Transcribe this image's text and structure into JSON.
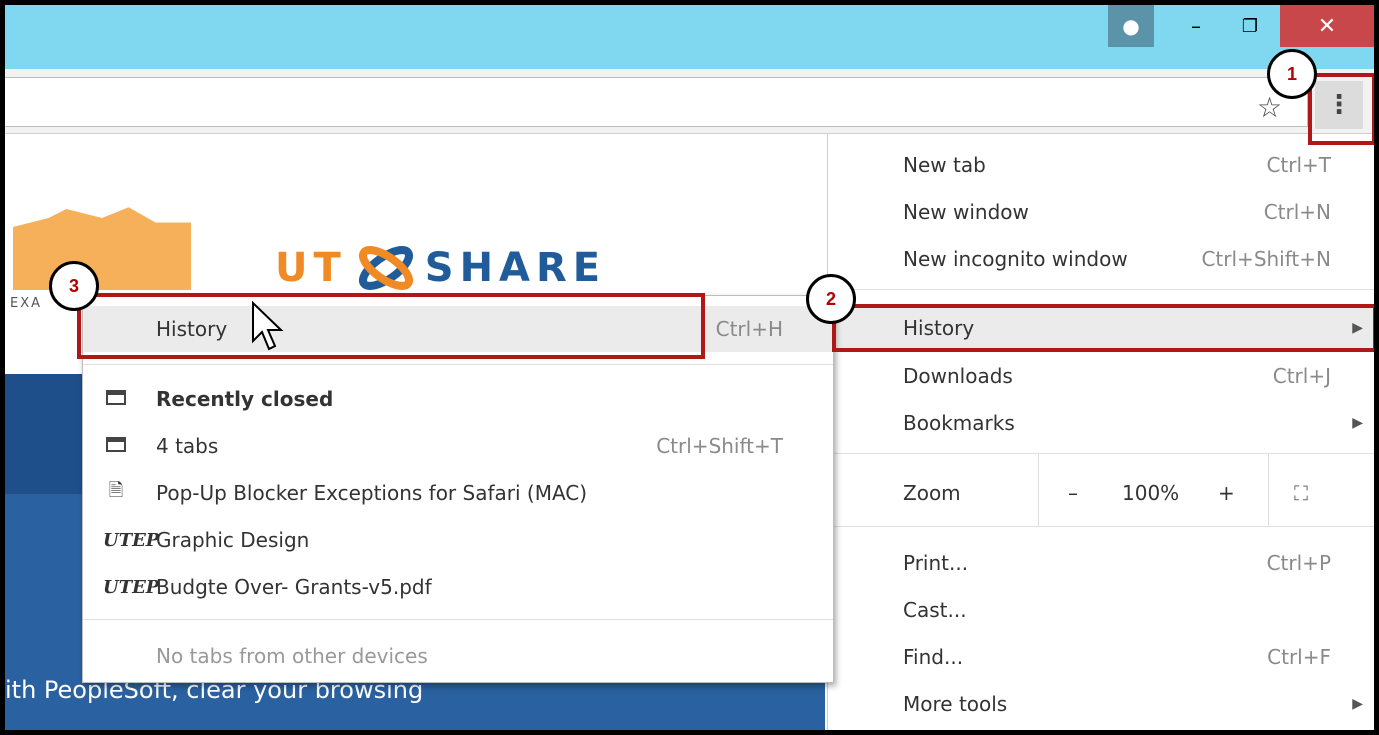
{
  "window": {
    "user_icon": "person-icon",
    "minimize": "–",
    "maximize": "❐",
    "close": "✕"
  },
  "toolbar": {
    "star_icon": "☆",
    "menu_icon": "⋮"
  },
  "page": {
    "logo_left": "UT",
    "logo_right": "SHARE",
    "exa": "EXA",
    "text": "ith PeopleSoft, clear your browsing"
  },
  "menu": {
    "items": [
      {
        "label": "New tab",
        "shortcut": "Ctrl+T"
      },
      {
        "label": "New window",
        "shortcut": "Ctrl+N"
      },
      {
        "label": "New incognito window",
        "shortcut": "Ctrl+Shift+N"
      },
      {
        "label": "History",
        "shortcut": ""
      },
      {
        "label": "Downloads",
        "shortcut": "Ctrl+J"
      },
      {
        "label": "Bookmarks",
        "shortcut": ""
      },
      {
        "label": "Zoom",
        "shortcut": ""
      },
      {
        "label": "Print...",
        "shortcut": "Ctrl+P"
      },
      {
        "label": "Cast...",
        "shortcut": ""
      },
      {
        "label": "Find...",
        "shortcut": "Ctrl+F"
      },
      {
        "label": "More tools",
        "shortcut": ""
      }
    ],
    "zoom": {
      "minus": "–",
      "value": "100%",
      "plus": "+",
      "fullscreen": "⛶"
    }
  },
  "history_submenu": {
    "history": {
      "label": "History",
      "shortcut": "Ctrl+H"
    },
    "recently_closed": "Recently closed",
    "items": [
      {
        "label": "4 tabs",
        "shortcut": "Ctrl+Shift+T",
        "icon": "tab-icon"
      },
      {
        "label": "Pop-Up Blocker Exceptions for Safari (MAC)",
        "shortcut": "",
        "icon": "page-icon"
      },
      {
        "label": "Graphic Design",
        "shortcut": "",
        "icon": "utep-icon"
      },
      {
        "label": "Budgte Over- Grants-v5.pdf",
        "shortcut": "",
        "icon": "utep-icon"
      }
    ],
    "no_tabs": "No tabs from other devices"
  },
  "callouts": {
    "one": "1",
    "two": "2",
    "three": "3"
  },
  "colors": {
    "titlebar": "#7fd8ef",
    "close": "#c8474b",
    "highlight_box": "#b01818"
  }
}
